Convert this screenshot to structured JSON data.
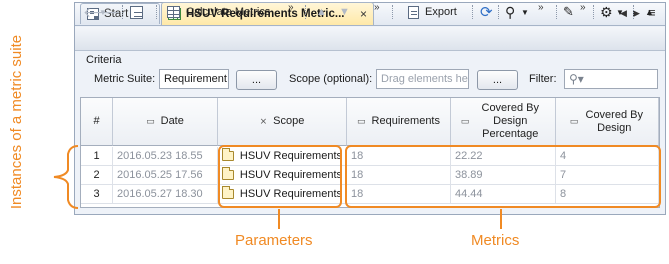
{
  "tabs": [
    {
      "label": "Start"
    },
    {
      "label": "HSUV Requirements Metric...",
      "close": "×"
    }
  ],
  "tab_nav": {
    "left": "◀",
    "right": "▶",
    "menu": "≡"
  },
  "toolbar": {
    "calculate_label": "Calculate Metrics",
    "export_label": "Export",
    "overflow": "»"
  },
  "criteria": {
    "label": "Criteria",
    "metric_suite_label": "Metric Suite:",
    "metric_suite_value": "Requirement",
    "browse_label": "...",
    "scope_label": "Scope (optional):",
    "scope_placeholder": "Drag elements here",
    "filter_label": "Filter:"
  },
  "table": {
    "columns": [
      "#",
      "Date",
      "Scope",
      "Requirements",
      "Covered By Design Percentage",
      "Covered By Design"
    ],
    "rows": [
      {
        "n": "1",
        "date": "2016.05.23 18.55",
        "scope": "HSUV Requirements",
        "requirements": "18",
        "pct": "22.22",
        "covered": "4"
      },
      {
        "n": "2",
        "date": "2016.05.25 17.56",
        "scope": "HSUV Requirements",
        "requirements": "18",
        "pct": "38.89",
        "covered": "7"
      },
      {
        "n": "3",
        "date": "2016.05.27 18.30",
        "scope": "HSUV Requirements",
        "requirements": "18",
        "pct": "44.44",
        "covered": "8"
      }
    ]
  },
  "annotations": {
    "instances": "Instances of a metric suite",
    "parameters": "Parameters",
    "metrics": "Metrics",
    "color": "#f08a24"
  }
}
